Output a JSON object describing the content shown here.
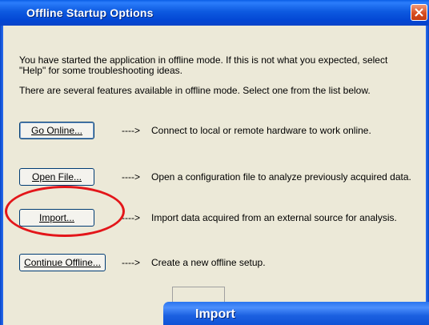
{
  "window": {
    "title": "Offline Startup Options"
  },
  "intro": {
    "line1": "You have started the application in offline mode. If this is not what you expected, select",
    "line2": "\"Help\" for some troubleshooting ideas.",
    "line3": "There are several features available in offline mode. Select one from the list below."
  },
  "options": [
    {
      "label": "Go Online...",
      "arrow": "---->",
      "description": "Connect to local or remote hardware to work online."
    },
    {
      "label": "Open File...",
      "arrow": "---->",
      "description": "Open a configuration file to analyze previously acquired data."
    },
    {
      "label": "Import...",
      "arrow": "---->",
      "description": "Import data acquired from an external source for analysis."
    },
    {
      "label": "Continue Offline...",
      "arrow": "---->",
      "description": "Create a new offline setup."
    }
  ],
  "highlight": {
    "color": "#e3161a",
    "target": "import-button"
  },
  "import_window": {
    "title": "Import"
  },
  "colors": {
    "titlebar": "#0a4fd8",
    "client": "#ece9d8",
    "close": "#d84e22"
  }
}
